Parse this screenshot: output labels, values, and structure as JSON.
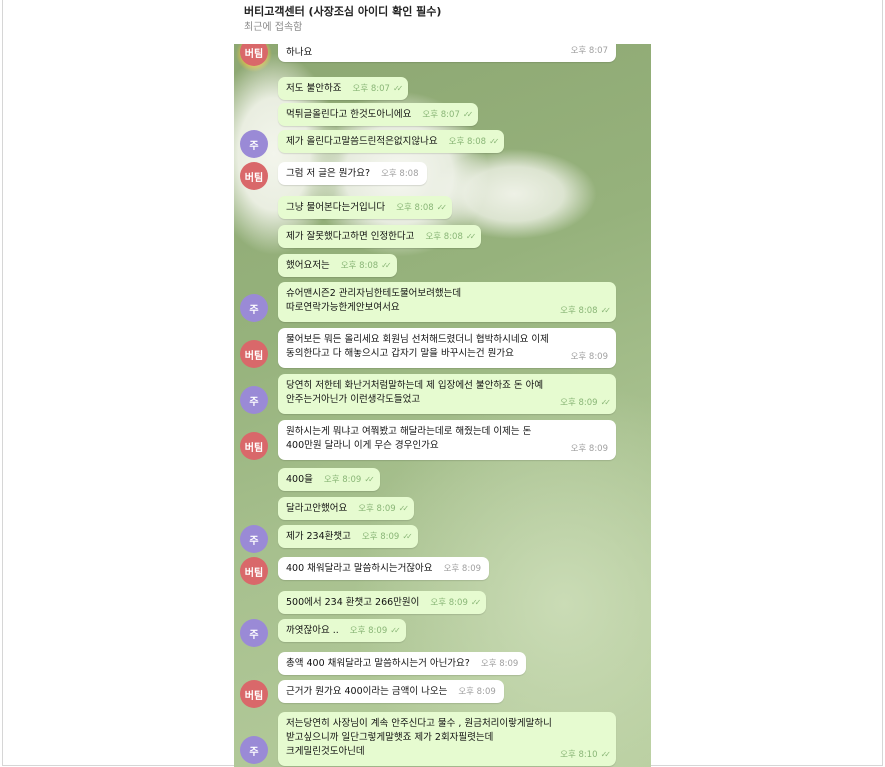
{
  "chat_title": "버티고객센터 (사장조심 아이디 확인 필수)",
  "status": "최근에 접속함",
  "avatars": {
    "red": "버팀",
    "purple": "주"
  },
  "messages": [
    {
      "text": "하나요",
      "time": "오후 8:07",
      "sent": false,
      "avatar": "버팀"
    },
    {
      "text": "저도 불안하죠",
      "time": "오후 8:07",
      "sent": true
    },
    {
      "text": "먹튀글올린다고 한것도아니에요",
      "time": "오후 8:07",
      "sent": true
    },
    {
      "text": "제가 올린다고말씀드린적은없지않나요",
      "time": "오후 8:08",
      "sent": true,
      "avatar": "주"
    },
    {
      "text": "그럼 저 글은 뭔가요?",
      "time": "오후 8:08",
      "sent": false,
      "avatar": "버팀"
    },
    {
      "text": "그냥 물어본다는거입니다",
      "time": "오후 8:08",
      "sent": true
    },
    {
      "text": "제가 잘못했다고하면  인정한다고",
      "time": "오후 8:08",
      "sent": true
    },
    {
      "text": "했어요저는",
      "time": "오후 8:08",
      "sent": true
    },
    {
      "text": "슈어맨시즌2 관리자님한테도물어보려했는데\n따로연락가능한게안보여서요",
      "time": "오후 8:08",
      "sent": true,
      "avatar": "주"
    },
    {
      "text": "물어보든 뭐든 올리세요 회원님 선처해드렸더니 협박하시네요 이제\n동의한다고 다 해놓으시고 갑자기 말을 바꾸시는건 뭔가요",
      "time": "오후 8:09",
      "sent": false,
      "avatar": "버팀"
    },
    {
      "text": "당연히 저한테 화난거처럼말하는데 제 입장에선 불안하죠  돈 아예\n안주는거아닌가 이런생각도들었고",
      "time": "오후 8:09",
      "sent": true,
      "avatar": "주"
    },
    {
      "text": "원하시는게 뭐냐고 여쭤봤고 해달라는데로 해줬는데 이제는 돈\n400만원 달라니 이게 무슨 경우인가요",
      "time": "오후 8:09",
      "sent": false,
      "avatar": "버팀"
    },
    {
      "text": "400을",
      "time": "오후 8:09",
      "sent": true
    },
    {
      "text": "달라고안했어요",
      "time": "오후 8:09",
      "sent": true
    },
    {
      "text": "제가 234환챗고",
      "time": "오후 8:09",
      "sent": true,
      "avatar": "주"
    },
    {
      "text": "400 채워달라고 말씀하시는거잖아요",
      "time": "오후 8:09",
      "sent": false,
      "avatar": "버팀"
    },
    {
      "text": "500에서 234 환챗고 266만원이",
      "time": "오후 8:09",
      "sent": true
    },
    {
      "text": "까엿잖아요 ..",
      "time": "오후 8:09",
      "sent": true,
      "avatar": "주"
    },
    {
      "text": "총액 400 채워달라고 말씀하시는거 아닌가요?",
      "time": "오후 8:09",
      "sent": false
    },
    {
      "text": "근거가 뭔가요 400이라는 금액이 나오는",
      "time": "오후 8:09",
      "sent": false,
      "avatar": "버팀"
    },
    {
      "text": "저는당연히 사장님이 계속 안주신다고  물수 , 원금처리이랗게말하니\n받고싶으니까 일단그렇게말햇죠 제가 2회자필렷는데\n크게밀린것도아닌데",
      "time": "오후 8:10",
      "sent": true,
      "avatar": "주"
    }
  ]
}
